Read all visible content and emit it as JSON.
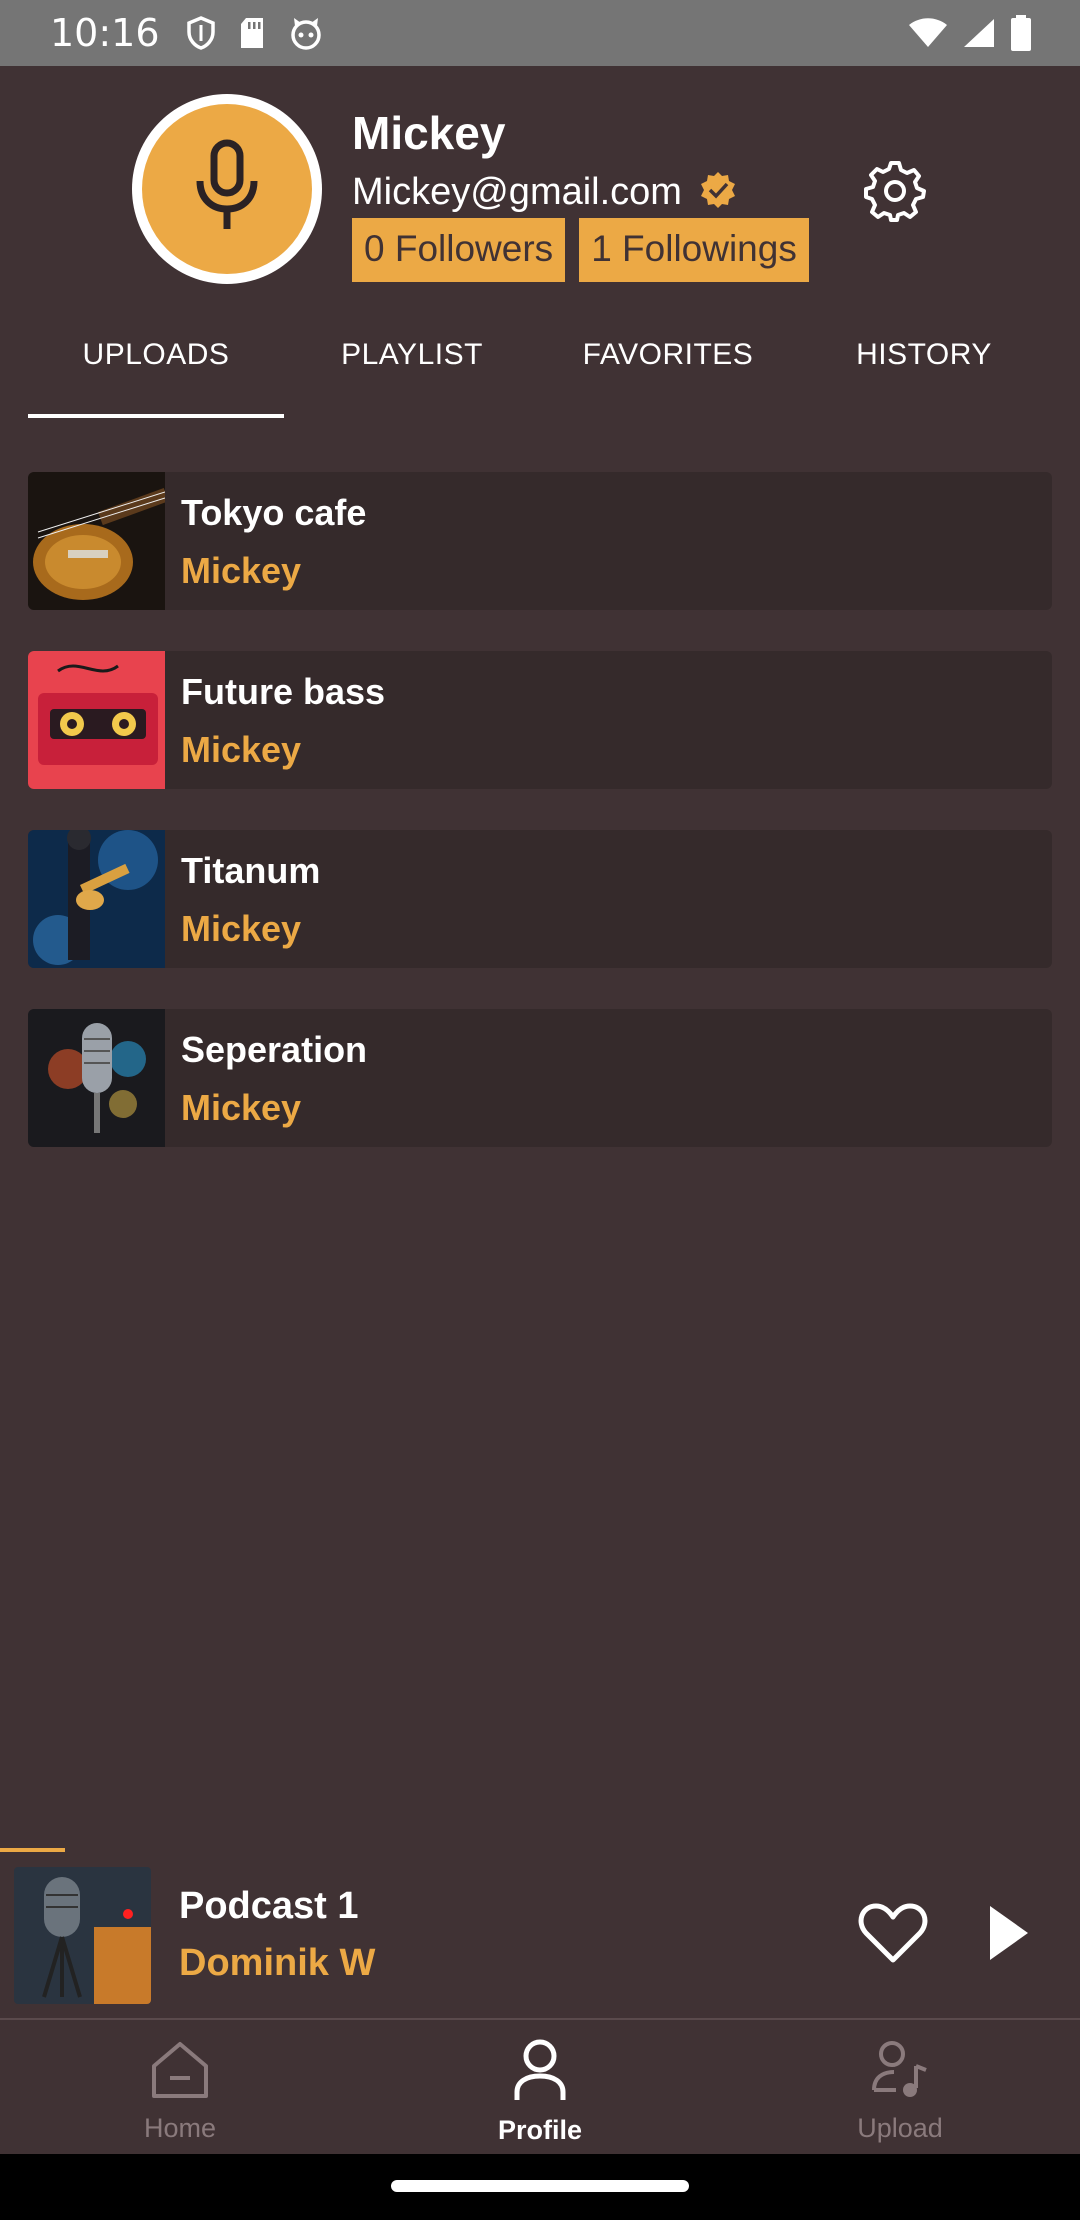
{
  "status_bar": {
    "time": "10:16",
    "left_icons": [
      "shield-icon",
      "sd-card-icon",
      "cat-icon"
    ],
    "right_icons": [
      "wifi-icon",
      "signal-icon",
      "battery-icon"
    ]
  },
  "profile": {
    "name": "Mickey",
    "email": "Mickey@gmail.com",
    "verified": true,
    "followers_label": "0 Followers",
    "followings_label": "1 Followings",
    "avatar_icon": "microphone-icon"
  },
  "tabs": [
    {
      "label": "UPLOADS",
      "active": true
    },
    {
      "label": "PLAYLIST",
      "active": false
    },
    {
      "label": "FAVORITES",
      "active": false
    },
    {
      "label": "HISTORY",
      "active": false
    }
  ],
  "uploads": [
    {
      "title": "Tokyo cafe",
      "artist": "Mickey",
      "thumb": "guitar-thumbnail"
    },
    {
      "title": "Future bass",
      "artist": "Mickey",
      "thumb": "cassette-thumbnail"
    },
    {
      "title": "Titanum",
      "artist": "Mickey",
      "thumb": "guitarist-thumbnail"
    },
    {
      "title": "Seperation",
      "artist": "Mickey",
      "thumb": "microphone-thumbnail"
    }
  ],
  "now_playing": {
    "title": "Podcast 1",
    "artist": "Dominik W",
    "progress": 0.06
  },
  "bottom_nav": [
    {
      "label": "Home",
      "icon": "home-icon",
      "active": false
    },
    {
      "label": "Profile",
      "icon": "person-icon",
      "active": true
    },
    {
      "label": "Upload",
      "icon": "upload-music-icon",
      "active": false
    }
  ],
  "colors": {
    "background": "#403234",
    "accent": "#ECA945",
    "card": "#352A2B",
    "status_bar": "#757575"
  }
}
